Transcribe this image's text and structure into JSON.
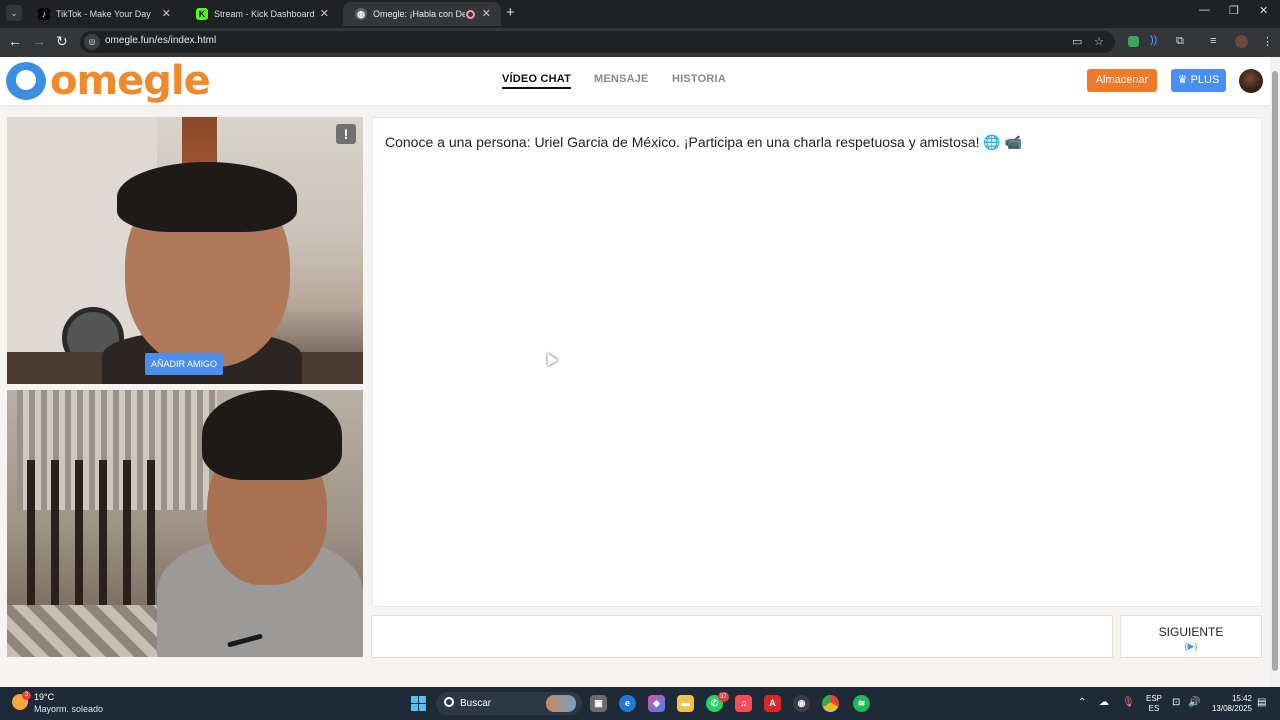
{
  "browser": {
    "tabs": [
      {
        "title": "TikTok - Make Your Day",
        "icon": "tiktok-icon",
        "favicon_color": "#000000"
      },
      {
        "title": "Stream - Kick Dashboard",
        "icon": "kick-icon",
        "favicon_color": "#53fc18"
      },
      {
        "title": "Omegle: ¡Habla con Desconocidos!",
        "icon": "globe-icon",
        "active": true
      }
    ],
    "url": "omegle.fun/es/index.html"
  },
  "header": {
    "logo_text": "omegle",
    "nav": [
      {
        "label": "VÍDEO CHAT",
        "active": true
      },
      {
        "label": "MENSAJE",
        "active": false
      },
      {
        "label": "HISTORIA",
        "active": false
      }
    ],
    "store_label": "Almacenar",
    "plus_label": "♛ PLUS"
  },
  "video": {
    "report_label": "!",
    "add_friend_label": "AÑADIR AMIGO"
  },
  "chat": {
    "message": "Conoce a una persona: Uriel Garcia de México. ¡Participa en una charla respetuosa y amistosa! 🌐 📹",
    "input_value": "",
    "next_label": "SIGUIENTE",
    "next_sub": "(▶)"
  },
  "taskbar": {
    "weather_temp": "19°C",
    "weather_desc": "Mayorm. soleado",
    "weather_badge": "3",
    "search_label": "Buscar",
    "whatsapp_badge": "37",
    "lang_top": "ESP",
    "lang_bottom": "ES",
    "time": "15:42",
    "date": "13/08/2025"
  },
  "colors": {
    "brand_orange": "#f08a2c",
    "brand_blue": "#4a8ff0",
    "page_background": "#f7f3f0"
  }
}
